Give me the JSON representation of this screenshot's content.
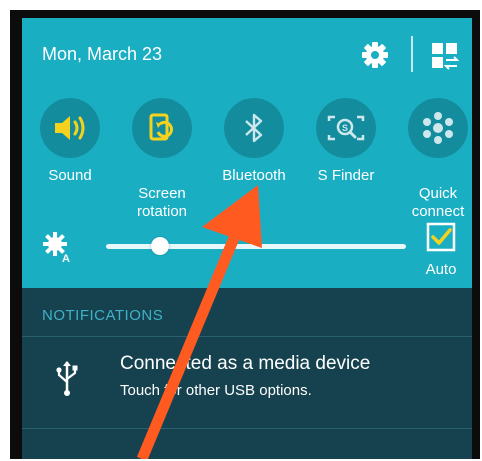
{
  "header": {
    "date": "Mon, March 23",
    "settings_icon": "gear-icon",
    "toggle_grid_icon": "grid-edit-icon"
  },
  "toggles": [
    {
      "label": "Sound",
      "icon": "speaker-icon",
      "active": true
    },
    {
      "label": "Screen\nrotation",
      "icon": "rotation-icon",
      "active": true
    },
    {
      "label": "Bluetooth",
      "icon": "bluetooth-icon",
      "active": false
    },
    {
      "label": "S Finder",
      "icon": "search-icon",
      "active": false
    },
    {
      "label": "Quick\nconnect",
      "icon": "quick-connect-icon",
      "active": false
    }
  ],
  "brightness": {
    "level": 0.18,
    "auto_label": "Auto",
    "auto_checked": true
  },
  "notifications": {
    "header": "NOTIFICATIONS",
    "items": [
      {
        "title": "Connected as a media device",
        "subtitle": "Touch for other USB options.",
        "icon": "usb-icon"
      }
    ]
  },
  "colors": {
    "panel": "#1aaec3",
    "toggle_circle": "#138d9d",
    "active_icon": "#f5d21d",
    "notifications_bg": "#16424f",
    "arrow": "#ff5a1f"
  }
}
